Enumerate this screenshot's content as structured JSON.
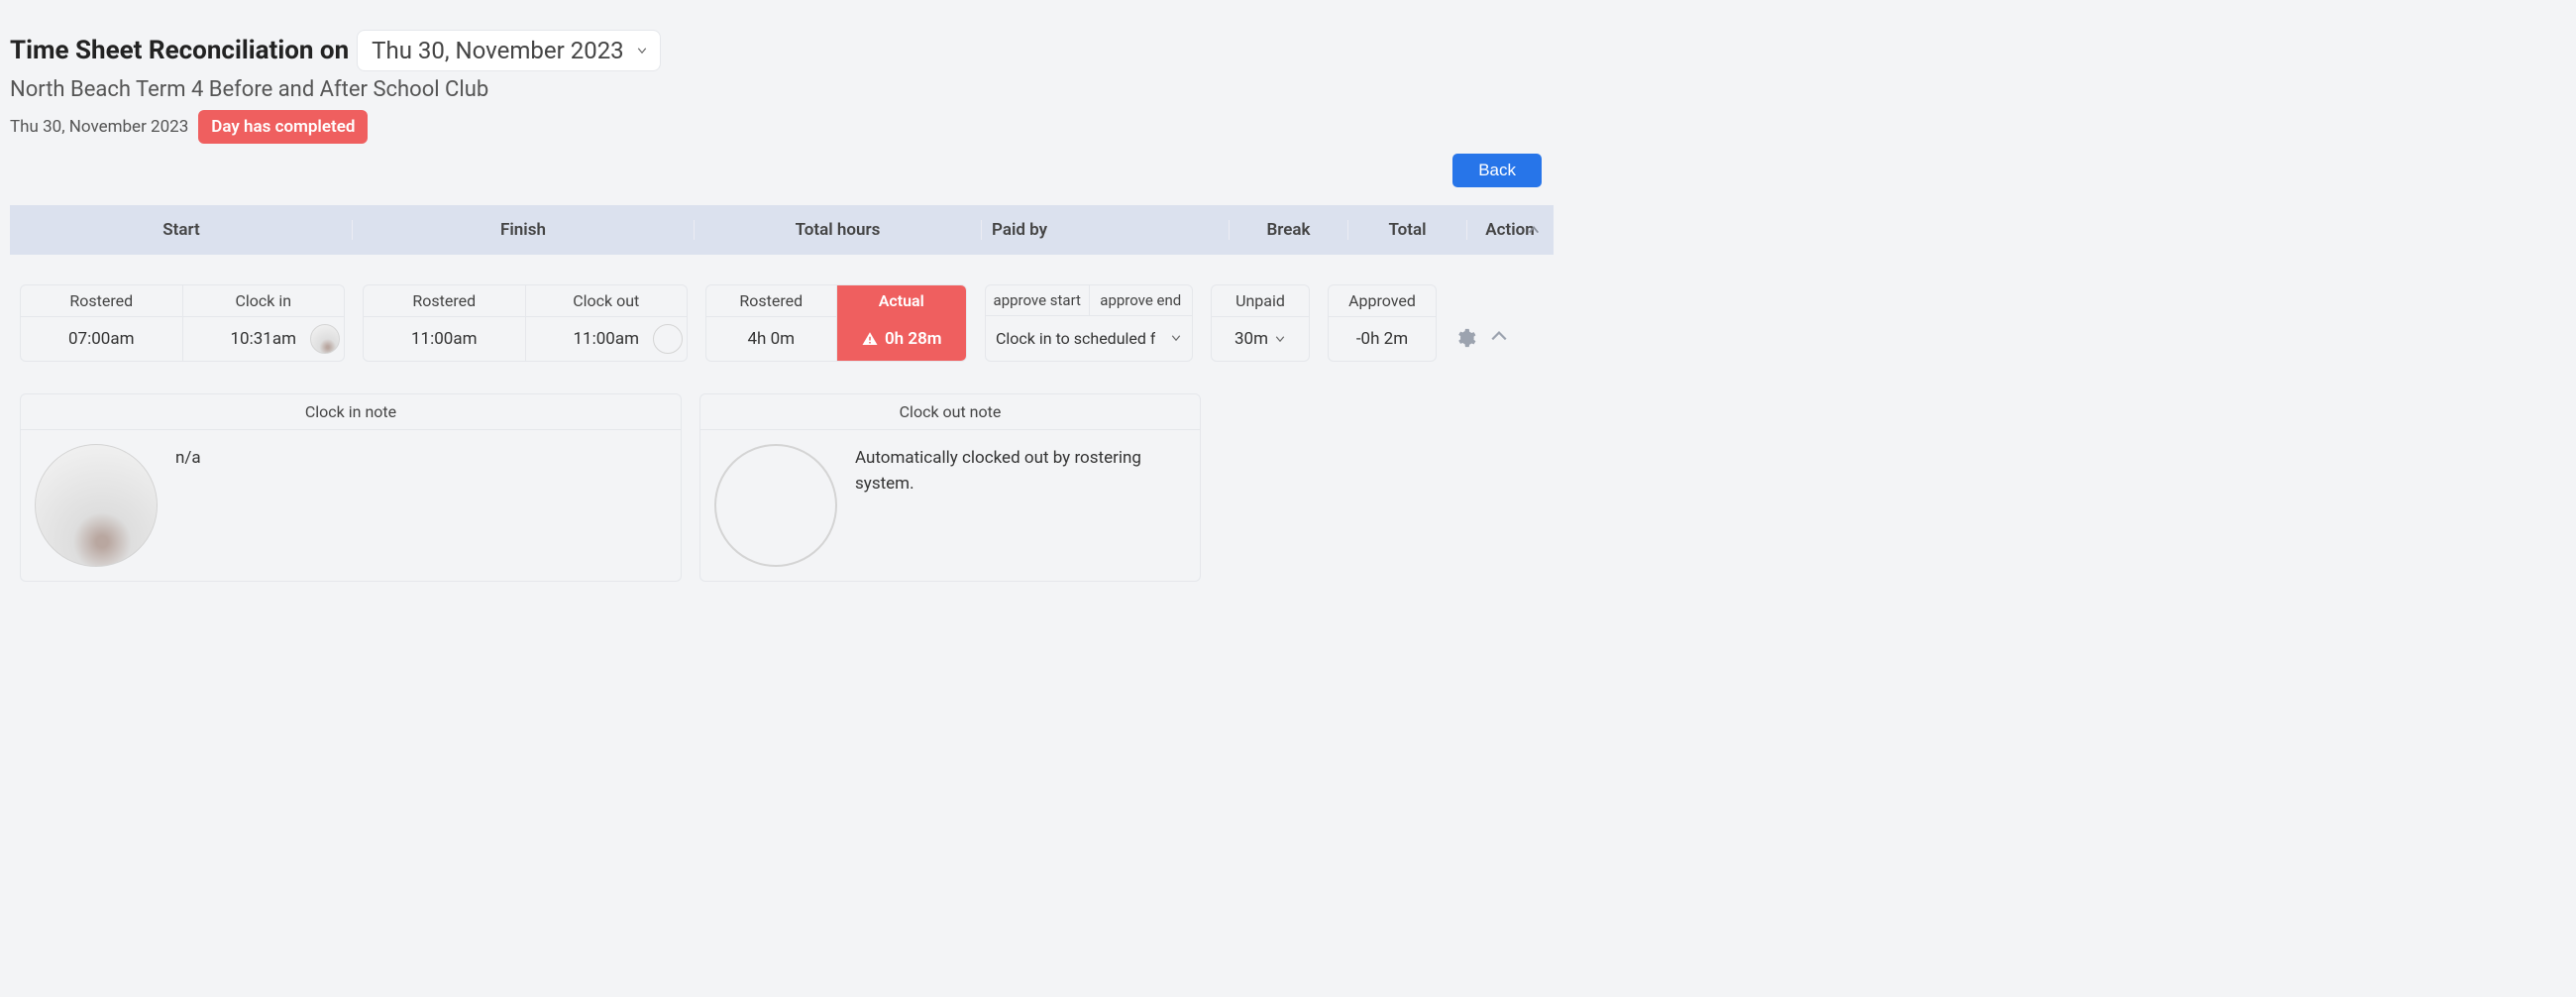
{
  "header": {
    "title_prefix": "Time Sheet Reconciliation on",
    "selected_date_label": "Thu 30, November 2023",
    "sub_line": "North Beach Term 4 Before and After School Club",
    "small_date": "Thu 30, November 2023",
    "status_badge": "Day has completed",
    "back_button": "Back"
  },
  "columns": {
    "start": "Start",
    "finish": "Finish",
    "total_hours": "Total hours",
    "paid_by": "Paid by",
    "break": "Break",
    "total": "Total",
    "action": "Action"
  },
  "row": {
    "start": {
      "rostered_label": "Rostered",
      "clock_in_label": "Clock in",
      "rostered_time": "07:00am",
      "clock_in_time": "10:31am"
    },
    "finish": {
      "rostered_label": "Rostered",
      "clock_out_label": "Clock out",
      "rostered_time": "11:00am",
      "clock_out_time": "11:00am"
    },
    "total_hours": {
      "rostered_label": "Rostered",
      "actual_label": "Actual",
      "rostered_value": "4h 0m",
      "actual_value": "0h 28m"
    },
    "paid_by": {
      "approve_start_label": "approve start",
      "approve_end_label": "approve end",
      "selected": "Clock in to scheduled f"
    },
    "break": {
      "unpaid_label": "Unpaid",
      "value": "30m"
    },
    "total": {
      "approved_label": "Approved",
      "value": "-0h 2m"
    }
  },
  "notes": {
    "clock_in": {
      "title": "Clock in note",
      "text": "n/a"
    },
    "clock_out": {
      "title": "Clock out note",
      "text": "Automatically clocked out by rostering system."
    }
  },
  "colors": {
    "accent_red": "#ef5f5f",
    "primary_blue": "#2775e9",
    "header_bg": "#dbe1ee"
  }
}
